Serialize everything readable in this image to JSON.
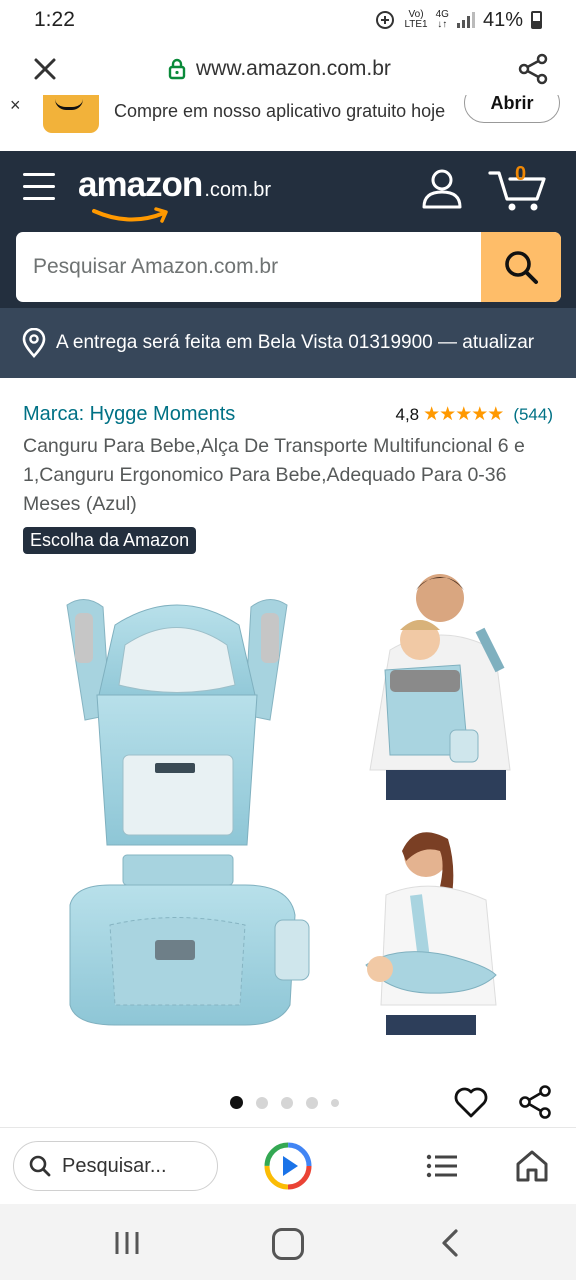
{
  "status": {
    "time": "1:22",
    "network_top": "Vo)",
    "network_bottom": "LTE1",
    "tech_top": "4G",
    "tech_bottom": "↓↑",
    "battery": "41%"
  },
  "browser": {
    "url": "www.amazon.com.br",
    "bottom_search_label": "Pesquisar..."
  },
  "banner": {
    "close": "×",
    "text": "Compre em nosso aplicativo gratuito hoje",
    "open_label": "Abrir"
  },
  "header": {
    "logo_word": "amazon",
    "logo_tld": ".com.br",
    "cart_count": "0",
    "search_placeholder": "Pesquisar Amazon.com.br"
  },
  "delivery": {
    "text": "A entrega será feita em Bela Vista 01319900 — atualizar"
  },
  "product": {
    "brand": "Marca: Hygge Moments",
    "rating": "4,8",
    "stars": "★★★★★",
    "reviews": "(544)",
    "title": "Canguru Para Bebe,Alça De Transporte Multifuncional 6 e 1,Canguru Ergonomico Para Bebe,Adequado Para 0-36 Meses (Azul)",
    "badge": "Escolha da Amazon",
    "image_count": 5,
    "active_image": 1
  },
  "colors": {
    "header_bg": "#232f3e",
    "delivery_bg": "#37475a",
    "search_button": "#febd69",
    "link": "#007185",
    "star": "#ff9900"
  }
}
